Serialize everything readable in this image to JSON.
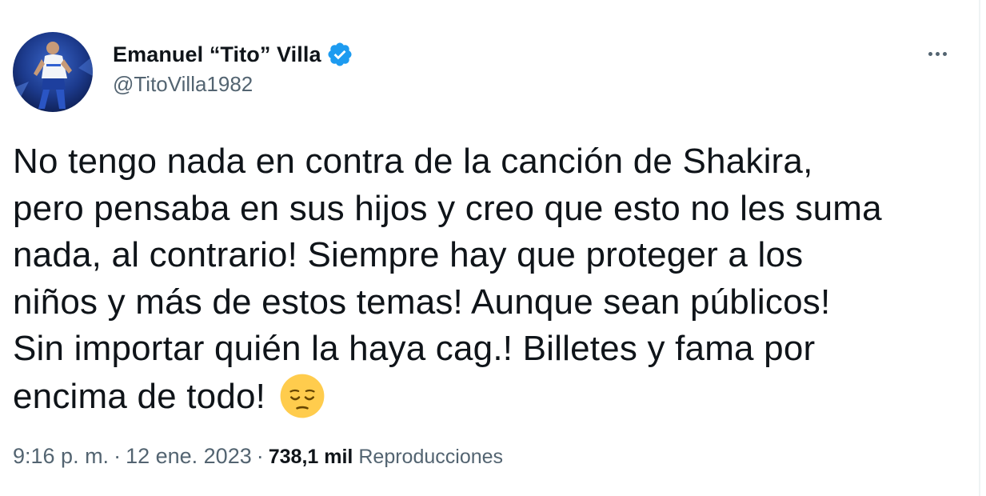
{
  "author": {
    "display_name": "Emanuel “Tito” Villa",
    "handle": "@TitoVilla1982",
    "verified": true,
    "avatar_icon": "profile-photo"
  },
  "menu": {
    "icon": "more-horizontal-icon"
  },
  "tweet": {
    "lines": [
      "No tengo nada en contra de la canción de Shakira,",
      "pero pensaba en sus hijos y creo que esto no les suma",
      "nada, al contrario! Siempre hay que proteger a los",
      "niños y más de estos temas! Aunque sean públicos!",
      "Sin importar quién la haya cag.! Billetes y fama por",
      "encima de todo!"
    ],
    "emoji": "pensive-face-emoji"
  },
  "meta": {
    "time": "9:16 p. m.",
    "separator": "·",
    "date": "12 ene. 2023",
    "views_count": "738,1 mil",
    "views_label": "Reproducciones"
  },
  "colors": {
    "text": "#0f1419",
    "secondary": "#536471",
    "verified_blue": "#1d9bf0",
    "emoji_yellow": "#ffcc4d"
  }
}
